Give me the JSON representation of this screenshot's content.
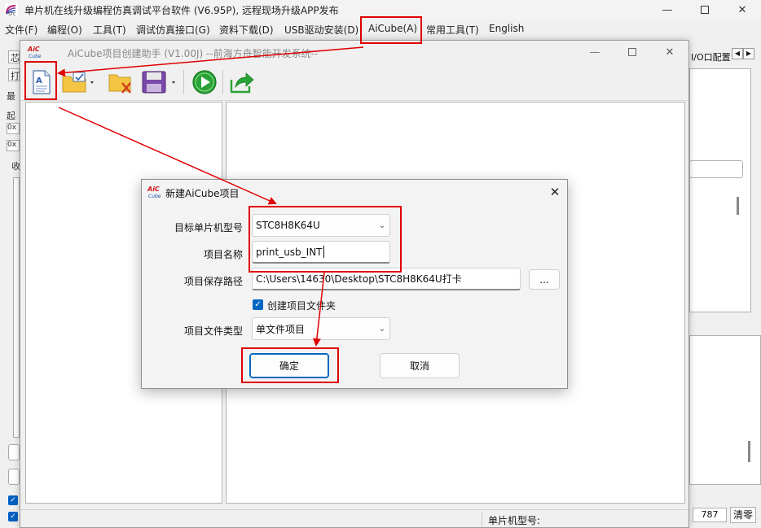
{
  "main_window": {
    "title": "单片机在线升级编程仿真调试平台软件 (V6.95P), 远程现场升级APP发布",
    "menu": [
      "文件(F)",
      "编程(O)",
      "工具(T)",
      "调试仿真接口(G)",
      "资料下载(D)",
      "USB驱动安装(D)",
      "AiCube(A)",
      "常用工具(T)",
      "English"
    ],
    "left_strip_labels": [
      "芯",
      "打",
      "最",
      "起",
      "0x",
      "0x",
      "收"
    ],
    "right_tab_label": "I/O口配置",
    "counter_value": "787",
    "clear_button": "清零"
  },
  "cube_window": {
    "title": "AiCube项目创建助手 (V1.00J) --前海方舟智能开发系统--",
    "status_label": "单片机型号:",
    "toolbar_icons": [
      "new-project-icon",
      "open-project-icon",
      "close-project-icon",
      "save-project-icon",
      "run-icon",
      "export-icon"
    ]
  },
  "dialog": {
    "title": "新建AiCube项目",
    "mcu_label": "目标单片机型号",
    "mcu_value": "STC8H8K64U",
    "name_label": "项目名称",
    "name_value": "print_usb_INT",
    "path_label": "项目保存路径",
    "path_value": "C:\\Users\\14630\\Desktop\\STC8H8K64U打卡",
    "browse_label": "...",
    "create_folder_label": "创建项目文件夹",
    "create_folder_checked": true,
    "file_type_label": "项目文件类型",
    "file_type_value": "单文件项目",
    "ok_label": "确定",
    "cancel_label": "取消"
  },
  "colors": {
    "highlight": "#e00000",
    "accent": "#0067c0"
  }
}
